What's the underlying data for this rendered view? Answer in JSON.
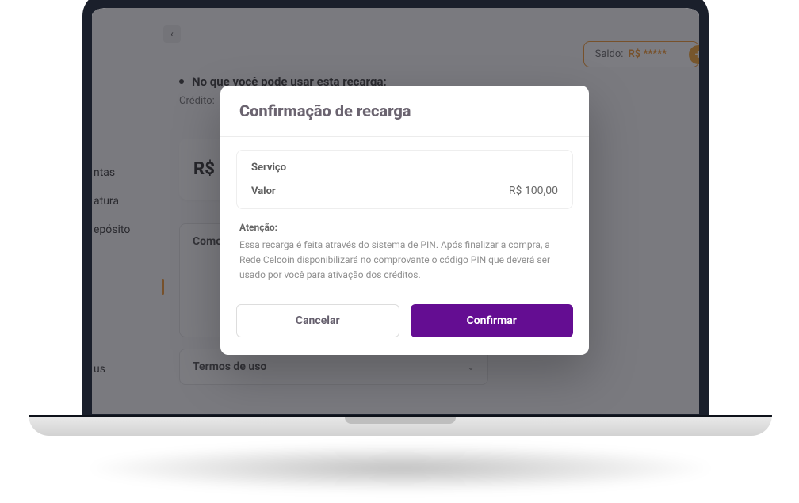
{
  "header": {
    "saldo_label": "Saldo:",
    "saldo_value": "R$ *****"
  },
  "sidebar": {
    "items": [
      "ntas",
      "atura",
      "epósito",
      "us"
    ]
  },
  "page": {
    "bullet_title": "No que você pode usar esta recarga:",
    "subtext": "Crédito:",
    "big_price_prefix": "R$",
    "como_label": "Como",
    "terms_label": "Termos de uso"
  },
  "modal": {
    "title": "Confirmação de recarga",
    "service_label": "Serviço",
    "value_label": "Valor",
    "value_amount": "R$ 100,00",
    "attention_label": "Atenção:",
    "attention_text": "Essa recarga é feita através do sistema de PIN. Após finalizar a compra, a Rede Celcoin disponibilizará no comprovante o código PIN que deverá ser usado por você para ativação dos créditos.",
    "cancel": "Cancelar",
    "confirm": "Confirmar"
  }
}
